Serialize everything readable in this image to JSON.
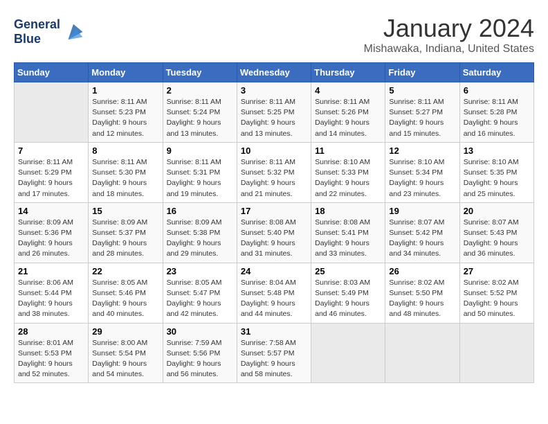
{
  "header": {
    "logo_line1": "General",
    "logo_line2": "Blue",
    "month_year": "January 2024",
    "location": "Mishawaka, Indiana, United States"
  },
  "days_of_week": [
    "Sunday",
    "Monday",
    "Tuesday",
    "Wednesday",
    "Thursday",
    "Friday",
    "Saturday"
  ],
  "weeks": [
    [
      {
        "day": "",
        "sunrise": "",
        "sunset": "",
        "daylight": "",
        "empty": true
      },
      {
        "day": "1",
        "sunrise": "Sunrise: 8:11 AM",
        "sunset": "Sunset: 5:23 PM",
        "daylight": "Daylight: 9 hours and 12 minutes."
      },
      {
        "day": "2",
        "sunrise": "Sunrise: 8:11 AM",
        "sunset": "Sunset: 5:24 PM",
        "daylight": "Daylight: 9 hours and 13 minutes."
      },
      {
        "day": "3",
        "sunrise": "Sunrise: 8:11 AM",
        "sunset": "Sunset: 5:25 PM",
        "daylight": "Daylight: 9 hours and 13 minutes."
      },
      {
        "day": "4",
        "sunrise": "Sunrise: 8:11 AM",
        "sunset": "Sunset: 5:26 PM",
        "daylight": "Daylight: 9 hours and 14 minutes."
      },
      {
        "day": "5",
        "sunrise": "Sunrise: 8:11 AM",
        "sunset": "Sunset: 5:27 PM",
        "daylight": "Daylight: 9 hours and 15 minutes."
      },
      {
        "day": "6",
        "sunrise": "Sunrise: 8:11 AM",
        "sunset": "Sunset: 5:28 PM",
        "daylight": "Daylight: 9 hours and 16 minutes."
      }
    ],
    [
      {
        "day": "7",
        "sunrise": "Sunrise: 8:11 AM",
        "sunset": "Sunset: 5:29 PM",
        "daylight": "Daylight: 9 hours and 17 minutes."
      },
      {
        "day": "8",
        "sunrise": "Sunrise: 8:11 AM",
        "sunset": "Sunset: 5:30 PM",
        "daylight": "Daylight: 9 hours and 18 minutes."
      },
      {
        "day": "9",
        "sunrise": "Sunrise: 8:11 AM",
        "sunset": "Sunset: 5:31 PM",
        "daylight": "Daylight: 9 hours and 19 minutes."
      },
      {
        "day": "10",
        "sunrise": "Sunrise: 8:11 AM",
        "sunset": "Sunset: 5:32 PM",
        "daylight": "Daylight: 9 hours and 21 minutes."
      },
      {
        "day": "11",
        "sunrise": "Sunrise: 8:10 AM",
        "sunset": "Sunset: 5:33 PM",
        "daylight": "Daylight: 9 hours and 22 minutes."
      },
      {
        "day": "12",
        "sunrise": "Sunrise: 8:10 AM",
        "sunset": "Sunset: 5:34 PM",
        "daylight": "Daylight: 9 hours and 23 minutes."
      },
      {
        "day": "13",
        "sunrise": "Sunrise: 8:10 AM",
        "sunset": "Sunset: 5:35 PM",
        "daylight": "Daylight: 9 hours and 25 minutes."
      }
    ],
    [
      {
        "day": "14",
        "sunrise": "Sunrise: 8:09 AM",
        "sunset": "Sunset: 5:36 PM",
        "daylight": "Daylight: 9 hours and 26 minutes."
      },
      {
        "day": "15",
        "sunrise": "Sunrise: 8:09 AM",
        "sunset": "Sunset: 5:37 PM",
        "daylight": "Daylight: 9 hours and 28 minutes."
      },
      {
        "day": "16",
        "sunrise": "Sunrise: 8:09 AM",
        "sunset": "Sunset: 5:38 PM",
        "daylight": "Daylight: 9 hours and 29 minutes."
      },
      {
        "day": "17",
        "sunrise": "Sunrise: 8:08 AM",
        "sunset": "Sunset: 5:40 PM",
        "daylight": "Daylight: 9 hours and 31 minutes."
      },
      {
        "day": "18",
        "sunrise": "Sunrise: 8:08 AM",
        "sunset": "Sunset: 5:41 PM",
        "daylight": "Daylight: 9 hours and 33 minutes."
      },
      {
        "day": "19",
        "sunrise": "Sunrise: 8:07 AM",
        "sunset": "Sunset: 5:42 PM",
        "daylight": "Daylight: 9 hours and 34 minutes."
      },
      {
        "day": "20",
        "sunrise": "Sunrise: 8:07 AM",
        "sunset": "Sunset: 5:43 PM",
        "daylight": "Daylight: 9 hours and 36 minutes."
      }
    ],
    [
      {
        "day": "21",
        "sunrise": "Sunrise: 8:06 AM",
        "sunset": "Sunset: 5:44 PM",
        "daylight": "Daylight: 9 hours and 38 minutes."
      },
      {
        "day": "22",
        "sunrise": "Sunrise: 8:05 AM",
        "sunset": "Sunset: 5:46 PM",
        "daylight": "Daylight: 9 hours and 40 minutes."
      },
      {
        "day": "23",
        "sunrise": "Sunrise: 8:05 AM",
        "sunset": "Sunset: 5:47 PM",
        "daylight": "Daylight: 9 hours and 42 minutes."
      },
      {
        "day": "24",
        "sunrise": "Sunrise: 8:04 AM",
        "sunset": "Sunset: 5:48 PM",
        "daylight": "Daylight: 9 hours and 44 minutes."
      },
      {
        "day": "25",
        "sunrise": "Sunrise: 8:03 AM",
        "sunset": "Sunset: 5:49 PM",
        "daylight": "Daylight: 9 hours and 46 minutes."
      },
      {
        "day": "26",
        "sunrise": "Sunrise: 8:02 AM",
        "sunset": "Sunset: 5:50 PM",
        "daylight": "Daylight: 9 hours and 48 minutes."
      },
      {
        "day": "27",
        "sunrise": "Sunrise: 8:02 AM",
        "sunset": "Sunset: 5:52 PM",
        "daylight": "Daylight: 9 hours and 50 minutes."
      }
    ],
    [
      {
        "day": "28",
        "sunrise": "Sunrise: 8:01 AM",
        "sunset": "Sunset: 5:53 PM",
        "daylight": "Daylight: 9 hours and 52 minutes."
      },
      {
        "day": "29",
        "sunrise": "Sunrise: 8:00 AM",
        "sunset": "Sunset: 5:54 PM",
        "daylight": "Daylight: 9 hours and 54 minutes."
      },
      {
        "day": "30",
        "sunrise": "Sunrise: 7:59 AM",
        "sunset": "Sunset: 5:56 PM",
        "daylight": "Daylight: 9 hours and 56 minutes."
      },
      {
        "day": "31",
        "sunrise": "Sunrise: 7:58 AM",
        "sunset": "Sunset: 5:57 PM",
        "daylight": "Daylight: 9 hours and 58 minutes."
      },
      {
        "day": "",
        "sunrise": "",
        "sunset": "",
        "daylight": "",
        "empty": true
      },
      {
        "day": "",
        "sunrise": "",
        "sunset": "",
        "daylight": "",
        "empty": true
      },
      {
        "day": "",
        "sunrise": "",
        "sunset": "",
        "daylight": "",
        "empty": true
      }
    ]
  ]
}
